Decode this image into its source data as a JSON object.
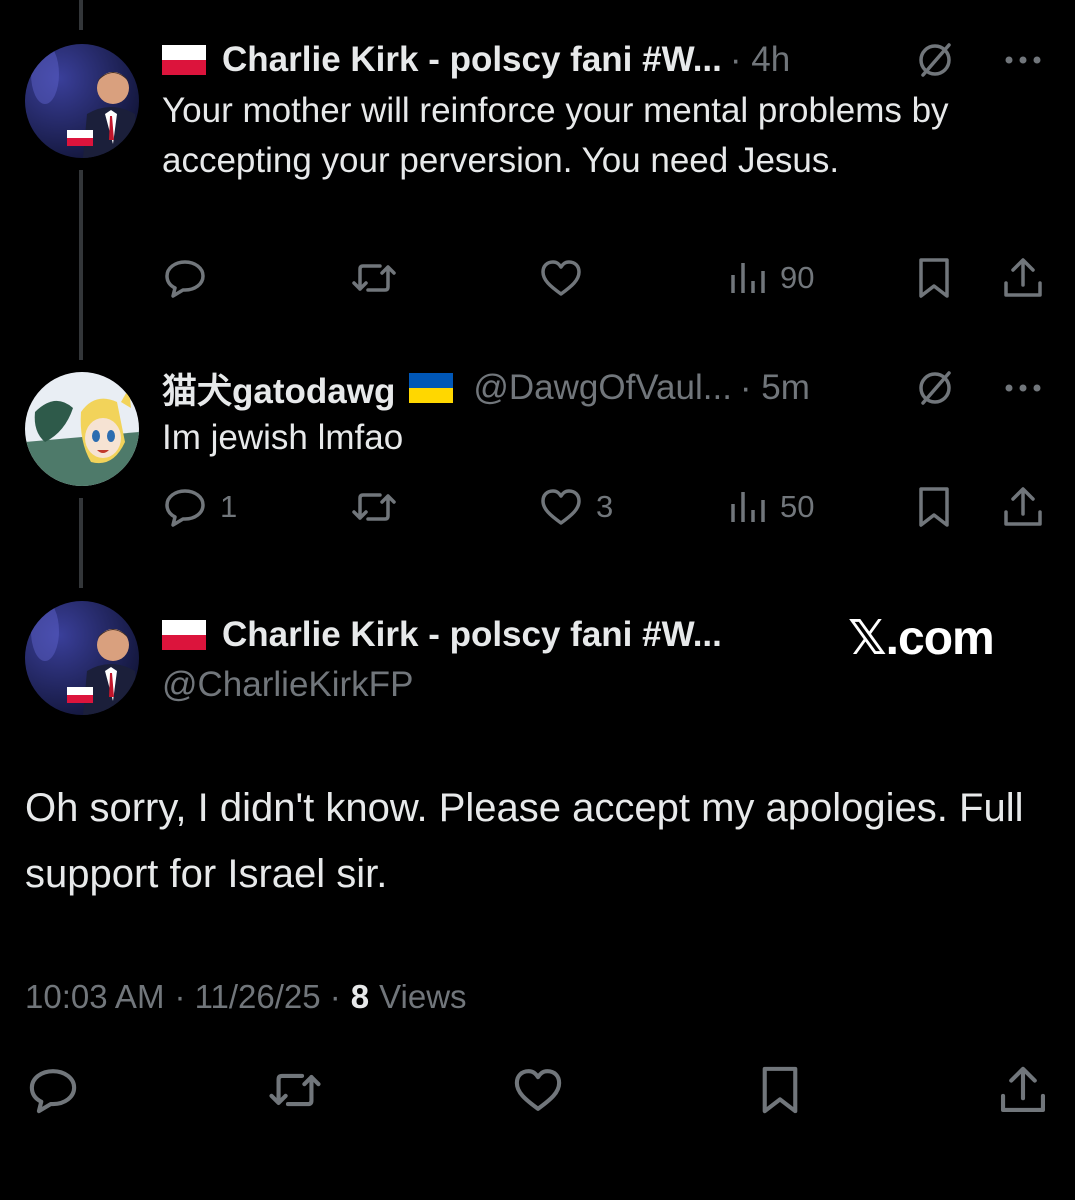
{
  "thread": {
    "replies": [
      {
        "flag": "🇵🇱",
        "display_name": "Charlie Kirk - polscy fani #W...",
        "handle": "",
        "time": "· 4h",
        "text": "Your mother will reinforce your mental problems by accepting your perversion. You need Jesus.",
        "stats": {
          "replies": "",
          "reposts": "",
          "likes": "",
          "views": "90"
        }
      },
      {
        "flag": "🇺🇦",
        "display_name": "猫犬gatodawg",
        "handle": "@DawgOfVaul...",
        "time": "· 5m",
        "text": "Im jewish lmfao",
        "stats": {
          "replies": "1",
          "reposts": "",
          "likes": "3",
          "views": "50"
        }
      }
    ]
  },
  "main_post": {
    "flag": "🇵🇱",
    "display_name": "Charlie Kirk - polscy fani #W...",
    "handle": "@CharlieKirkFP",
    "text": "Oh sorry, I didn't know. Please accept my apologies. Full support for Israel sir.",
    "time": "10:03 AM",
    "date": "· 11/26/25 ·",
    "views_count": "8",
    "views_label": "Views"
  },
  "watermark": "𝕏.com",
  "colors": {
    "background": "#000000",
    "text_primary": "#e7e9ea",
    "text_secondary": "#71767b",
    "thread_line": "#333639"
  },
  "icons": [
    "reply-icon",
    "repost-icon",
    "like-icon",
    "views-icon",
    "bookmark-icon",
    "share-icon",
    "grok-icon",
    "more-icon"
  ]
}
